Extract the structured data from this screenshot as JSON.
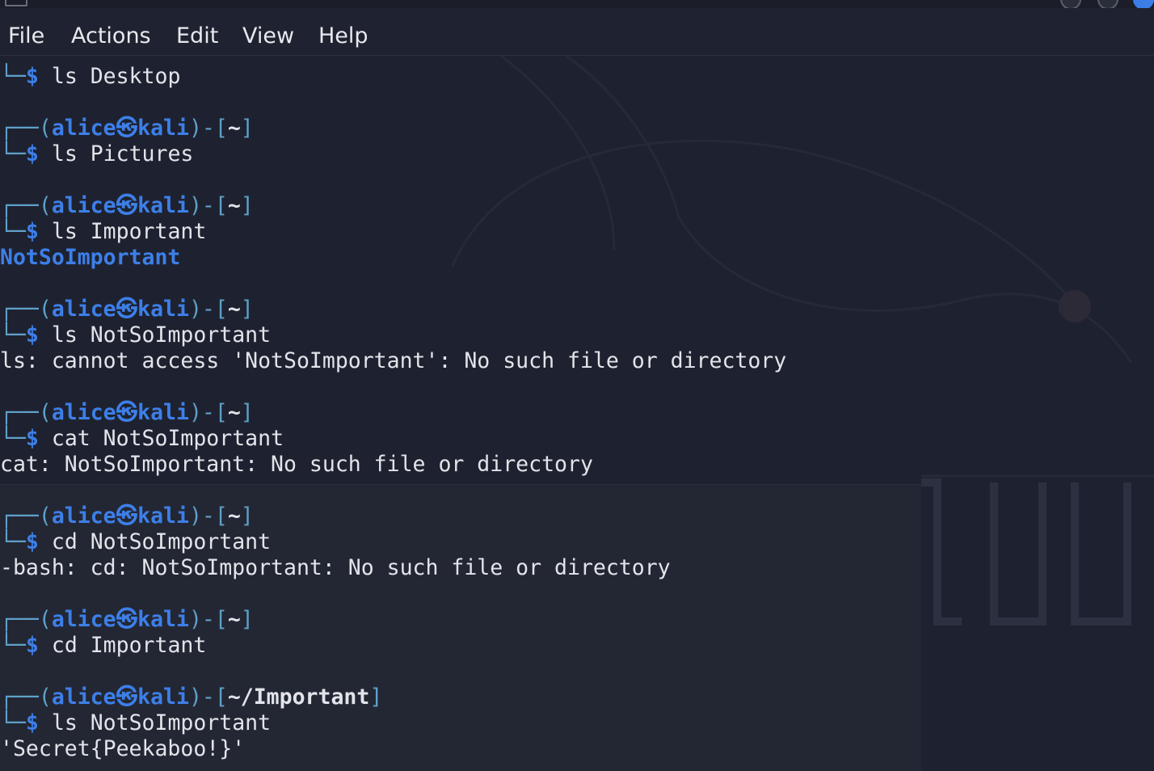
{
  "menu": {
    "file": "File",
    "actions": "Actions",
    "edit": "Edit",
    "view": "View",
    "help": "Help"
  },
  "prompt": {
    "user": "alice",
    "at": "㉿",
    "host": "kali",
    "dollar": "$"
  },
  "terminal": {
    "cmd0": "ls Desktop",
    "dir1": "~",
    "cmd1": "ls Pictures",
    "dir2": "~",
    "cmd2": "ls Important",
    "out2": "NotSoImportant",
    "dir3": "~",
    "cmd3": "ls NotSoImportant",
    "out3": "ls: cannot access 'NotSoImportant': No such file or directory",
    "dir4": "~",
    "cmd4": "cat NotSoImportant",
    "out4": "cat: NotSoImportant: No such file or directory",
    "dir5": "~",
    "cmd5": "cd NotSoImportant",
    "out5": "-bash: cd: NotSoImportant: No such file or directory",
    "dir6": "~",
    "cmd6": "cd Important",
    "dir7": "~/Important",
    "cmd7": "ls NotSoImportant",
    "out7": "'Secret{Peekaboo!}'"
  },
  "colors": {
    "background": "#1e2230",
    "prompt_blue": "#3d7fe8",
    "frame": "#5fa0c8",
    "text": "#e3e4ea"
  }
}
